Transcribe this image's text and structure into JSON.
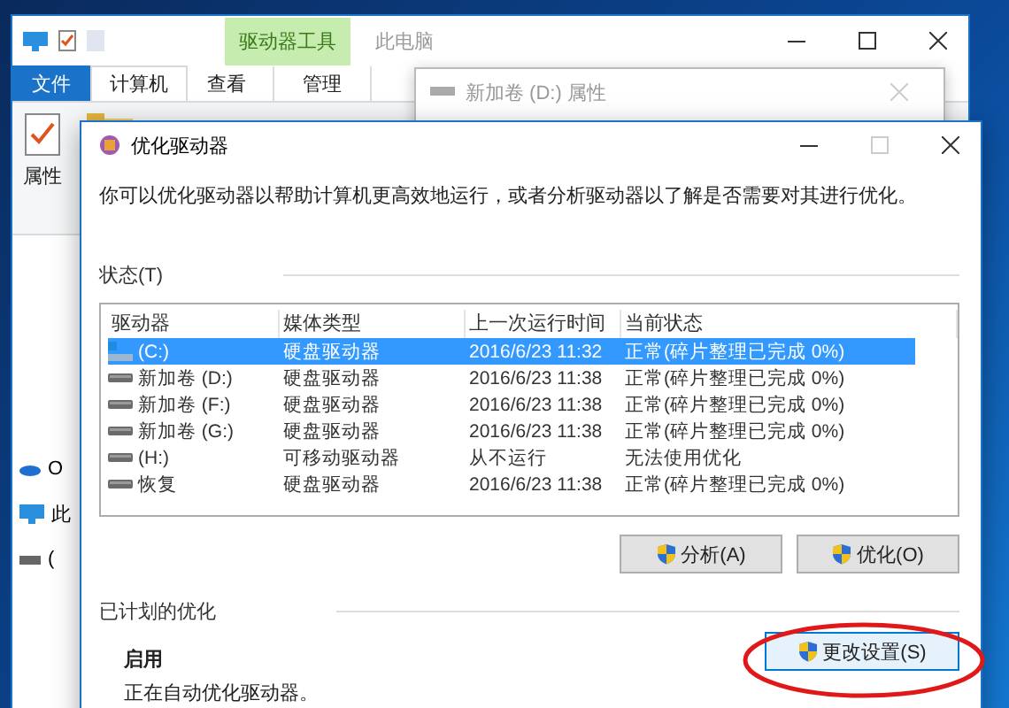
{
  "explorer": {
    "context_tab": "驱动器工具",
    "title": "此电脑",
    "tabs": [
      {
        "label": "文件",
        "kind": "file",
        "selected": false
      },
      {
        "label": "计算机",
        "kind": "tab",
        "selected": true
      },
      {
        "label": "查看",
        "kind": "tab",
        "selected": false
      },
      {
        "label": "管理",
        "kind": "context",
        "selected": false
      }
    ],
    "ribbon_button": "属性",
    "sidebar": [
      {
        "label": "O",
        "kind": "cloud"
      },
      {
        "label": "此",
        "kind": "pc"
      },
      {
        "label": "(",
        "kind": "drive"
      }
    ]
  },
  "properties_dialog": {
    "title": "新加卷 (D:) 属性"
  },
  "dialog": {
    "title": "优化驱动器",
    "description": "你可以优化驱动器以帮助计算机更高效地运行，或者分析驱动器以了解是否需要对其进行优化。",
    "status_label": "状态(T)",
    "columns": [
      "驱动器",
      "媒体类型",
      "上一次运行时间",
      "当前状态"
    ],
    "rows": [
      {
        "kind": "system",
        "drive": "(C:)",
        "media": "硬盘驱动器",
        "last_run": "2016/6/23 11:32",
        "status": "正常(碎片整理已完成 0%)",
        "selected": true
      },
      {
        "kind": "drive",
        "drive": "新加卷 (D:)",
        "media": "硬盘驱动器",
        "last_run": "2016/6/23 11:38",
        "status": "正常(碎片整理已完成 0%)",
        "selected": false
      },
      {
        "kind": "drive",
        "drive": "新加卷 (F:)",
        "media": "硬盘驱动器",
        "last_run": "2016/6/23 11:38",
        "status": "正常(碎片整理已完成 0%)",
        "selected": false
      },
      {
        "kind": "drive",
        "drive": "新加卷 (G:)",
        "media": "硬盘驱动器",
        "last_run": "2016/6/23 11:38",
        "status": "正常(碎片整理已完成 0%)",
        "selected": false
      },
      {
        "kind": "drive",
        "drive": "(H:)",
        "media": "可移动驱动器",
        "last_run": "从不运行",
        "status": "无法使用优化",
        "selected": false
      },
      {
        "kind": "drive",
        "drive": "恢复",
        "media": "硬盘驱动器",
        "last_run": "2016/6/23 11:38",
        "status": "正常(碎片整理已完成 0%)",
        "selected": false
      }
    ],
    "buttons": [
      "分析(A)",
      "优化(O)"
    ],
    "schedule_label": "已计划的优化",
    "schedule_state": "启用",
    "schedule_note": "正在自动优化驱动器。",
    "settings_button": "更改设置(S)",
    "settings_circled": true
  }
}
